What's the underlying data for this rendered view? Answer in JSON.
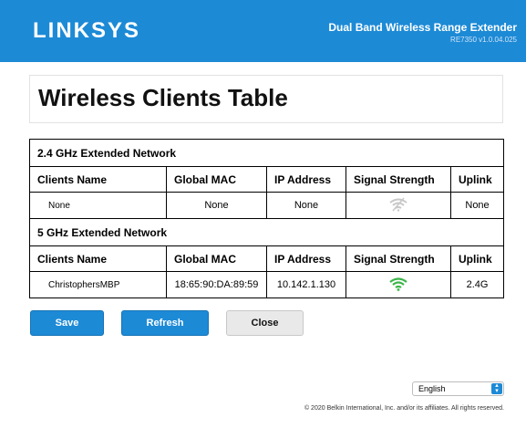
{
  "header": {
    "logo": "LINKSYS",
    "product_name": "Dual Band Wireless Range Extender",
    "model_version": "RE7350 v1.0.04.025"
  },
  "page": {
    "title": "Wireless Clients Table"
  },
  "columns": [
    "Clients Name",
    "Global MAC",
    "IP Address",
    "Signal Strength",
    "Uplink"
  ],
  "networks": [
    {
      "name": "2.4 GHz Extended Network",
      "client": {
        "name": "None",
        "mac": "None",
        "ip": "None",
        "signal_icon": "wifi-off-icon",
        "uplink": "None"
      }
    },
    {
      "name": "5 GHz Extended Network",
      "client": {
        "name": "ChristophersMBP",
        "mac": "18:65:90:DA:89:59",
        "ip": "10.142.1.130",
        "signal_icon": "wifi-full-icon",
        "uplink": "2.4G"
      }
    }
  ],
  "buttons": {
    "save": "Save",
    "refresh": "Refresh",
    "close": "Close"
  },
  "footer": {
    "language": "English",
    "copyright": "© 2020 Belkin International, Inc. and/or its affiliates. All rights reserved."
  },
  "colors": {
    "brand_blue": "#1d8ad6",
    "signal_good": "#3cb54a",
    "signal_off": "#c8c8c8"
  }
}
